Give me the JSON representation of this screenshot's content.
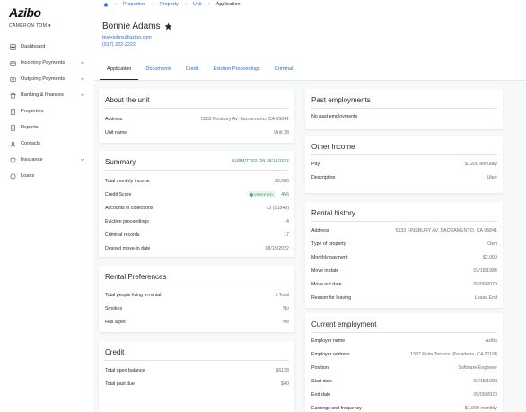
{
  "app": {
    "logo": "Azibo",
    "user": "CAMERON TOM ▾"
  },
  "sidebar": {
    "items": [
      {
        "label": "Dashboard",
        "icon": "dashboard-icon",
        "chevron": false
      },
      {
        "label": "Incoming Payments",
        "icon": "incoming-icon",
        "chevron": true
      },
      {
        "label": "Outgoing Payments",
        "icon": "outgoing-icon",
        "chevron": true
      },
      {
        "label": "Banking & finances",
        "icon": "bank-icon",
        "chevron": true
      },
      {
        "label": "Properties",
        "icon": "building-icon",
        "chevron": false
      },
      {
        "label": "Reports",
        "icon": "report-icon",
        "chevron": false
      },
      {
        "label": "Contacts",
        "icon": "contacts-icon",
        "chevron": false
      },
      {
        "label": "Insurance",
        "icon": "shield-icon",
        "chevron": true
      },
      {
        "label": "Loans",
        "icon": "loan-icon",
        "chevron": false
      }
    ]
  },
  "breadcrumb": {
    "items": [
      "Properties",
      "Property",
      "Unit"
    ],
    "current": "Application"
  },
  "header": {
    "name": "Bonnie Adams",
    "email": "test+johns@azibo.com",
    "phone": "(917) 222-2222"
  },
  "tabs": [
    "Application",
    "Documents",
    "Credit",
    "Eviction Proceedings",
    "Criminal"
  ],
  "about": {
    "title": "About the unit",
    "rows": [
      {
        "label": "Address",
        "value": "5333 Finsbury Av, Sacramento, CA 95841"
      },
      {
        "label": "Unit name",
        "value": "Unit 28"
      }
    ]
  },
  "summary": {
    "title": "Summary",
    "submitted": "SUBMITTED ON 08/19/2022",
    "verified": "VERIFIED",
    "rows": [
      {
        "label": "Total monthly income",
        "value": "$3,000"
      },
      {
        "label": "Credit Score",
        "value": "456"
      },
      {
        "label": "Accounts in collections",
        "value": "13 ($1849)"
      },
      {
        "label": "Eviction proceedings",
        "value": "4"
      },
      {
        "label": "Criminal records",
        "value": "17"
      },
      {
        "label": "Desired move-in date",
        "value": "08/19/2022"
      }
    ]
  },
  "rental_prefs": {
    "title": "Rental Preferences",
    "rows": [
      {
        "label": "Total people living in rental",
        "value": "1 Total"
      },
      {
        "label": "Smokes",
        "value": "No"
      },
      {
        "label": "Has a pet",
        "value": "No"
      }
    ]
  },
  "credit": {
    "title": "Credit",
    "rows": [
      {
        "label": "Total open balance",
        "value": "$6128"
      },
      {
        "label": "Total past due",
        "value": "$40"
      }
    ]
  },
  "past_employments": {
    "title": "Past employments",
    "empty": "No past employments"
  },
  "other_income": {
    "title": "Other Income",
    "rows": [
      {
        "label": "Pay",
        "value": "$1200 annually"
      },
      {
        "label": "Description",
        "value": "Uber"
      }
    ]
  },
  "rental_history": {
    "title": "Rental history",
    "rows": [
      {
        "label": "Address",
        "value": "5333 FINSBURY AV, SACRAMENTO, CA 95841"
      },
      {
        "label": "Type of property",
        "value": "Own"
      },
      {
        "label": "Monthly payment",
        "value": "$2,000"
      },
      {
        "label": "Move in date",
        "value": "07/18/1984"
      },
      {
        "label": "Move out date",
        "value": "09/09/2020"
      },
      {
        "label": "Reason for leaving",
        "value": "Lease End"
      }
    ]
  },
  "current_employment": {
    "title": "Current employment",
    "rows": [
      {
        "label": "Employer name",
        "value": "Azibo"
      },
      {
        "label": "Employer address",
        "value": "1337 Palm Terrace, Pasadena, CA 91104"
      },
      {
        "label": "Position",
        "value": "Software Engineer"
      },
      {
        "label": "Start date",
        "value": "07/18/1980"
      },
      {
        "label": "End date",
        "value": "09/09/2020"
      },
      {
        "label": "Earnings and frequency",
        "value": "$1,000 monthly"
      }
    ]
  },
  "colors": {
    "link": "#2a6fd6",
    "verified_green": "#2e8c56",
    "background": "#f7f8fa"
  }
}
